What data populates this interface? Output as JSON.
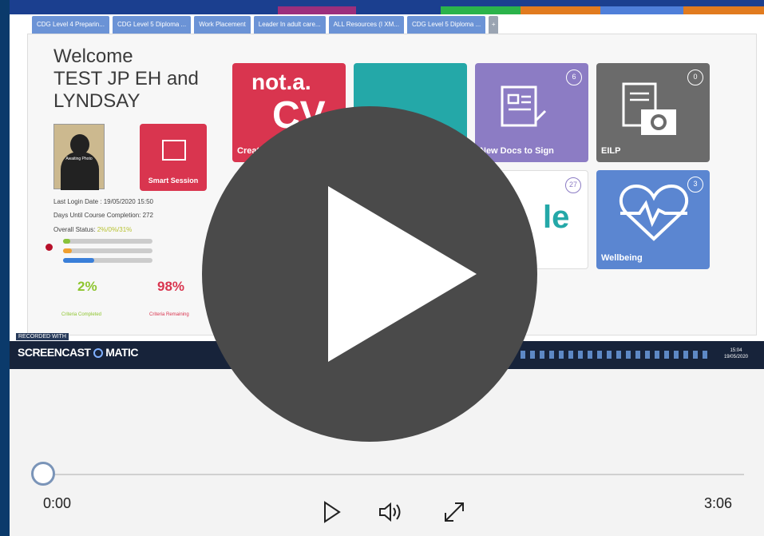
{
  "browser": {
    "tabs": [
      "CDG Level 4 Preparin...",
      "CDG Level 5 Diploma ...",
      "Work Placement",
      "Leader In adult care...",
      "ALL Resources (I XM...",
      "CDG Level 5 Diploma ..."
    ]
  },
  "dashboard": {
    "welcome": "Welcome",
    "user_name": "TEST JP EH and LYNDSAY",
    "avatar_text": "Awaiting Photo",
    "smart_session_label": "Smart Session",
    "last_login": "Last Login Date : 19/05/2020 15:50",
    "days_until": "Days Until Course Completion: 272",
    "overall_status_label": "Overall Status:",
    "overall_status_value": "2%/0%/31%",
    "progress": [
      0.08,
      0.1,
      0.35
    ],
    "completed_pct": "2%",
    "completed_label": "Criteria Completed",
    "remaining_pct": "98%",
    "remaining_label": "Criteria Remaining",
    "tiles": {
      "notacv_logo": "not.a.",
      "notacv_cv": "CV",
      "notacv_caption": "Creat",
      "newdocs_caption": "New Docs to Sign",
      "newdocs_count": "6",
      "eilp_caption": "EILP",
      "eilp_count": "0",
      "learning_count": "27",
      "learning_text": "le",
      "wellbeing_caption": "Wellbeing",
      "wellbeing_count": "3"
    }
  },
  "taskbar": {
    "recorded_with": "RECORDED WITH",
    "brand": "SCREENCAST",
    "brand_suffix": "MATIC",
    "clock_time": "15:04",
    "clock_date": "19/05/2020"
  },
  "player": {
    "current_time": "0:00",
    "duration": "3:06",
    "progress": 0.0,
    "colors": {
      "accent": "#7a94b8",
      "overlay": "#4a4a4a"
    }
  }
}
